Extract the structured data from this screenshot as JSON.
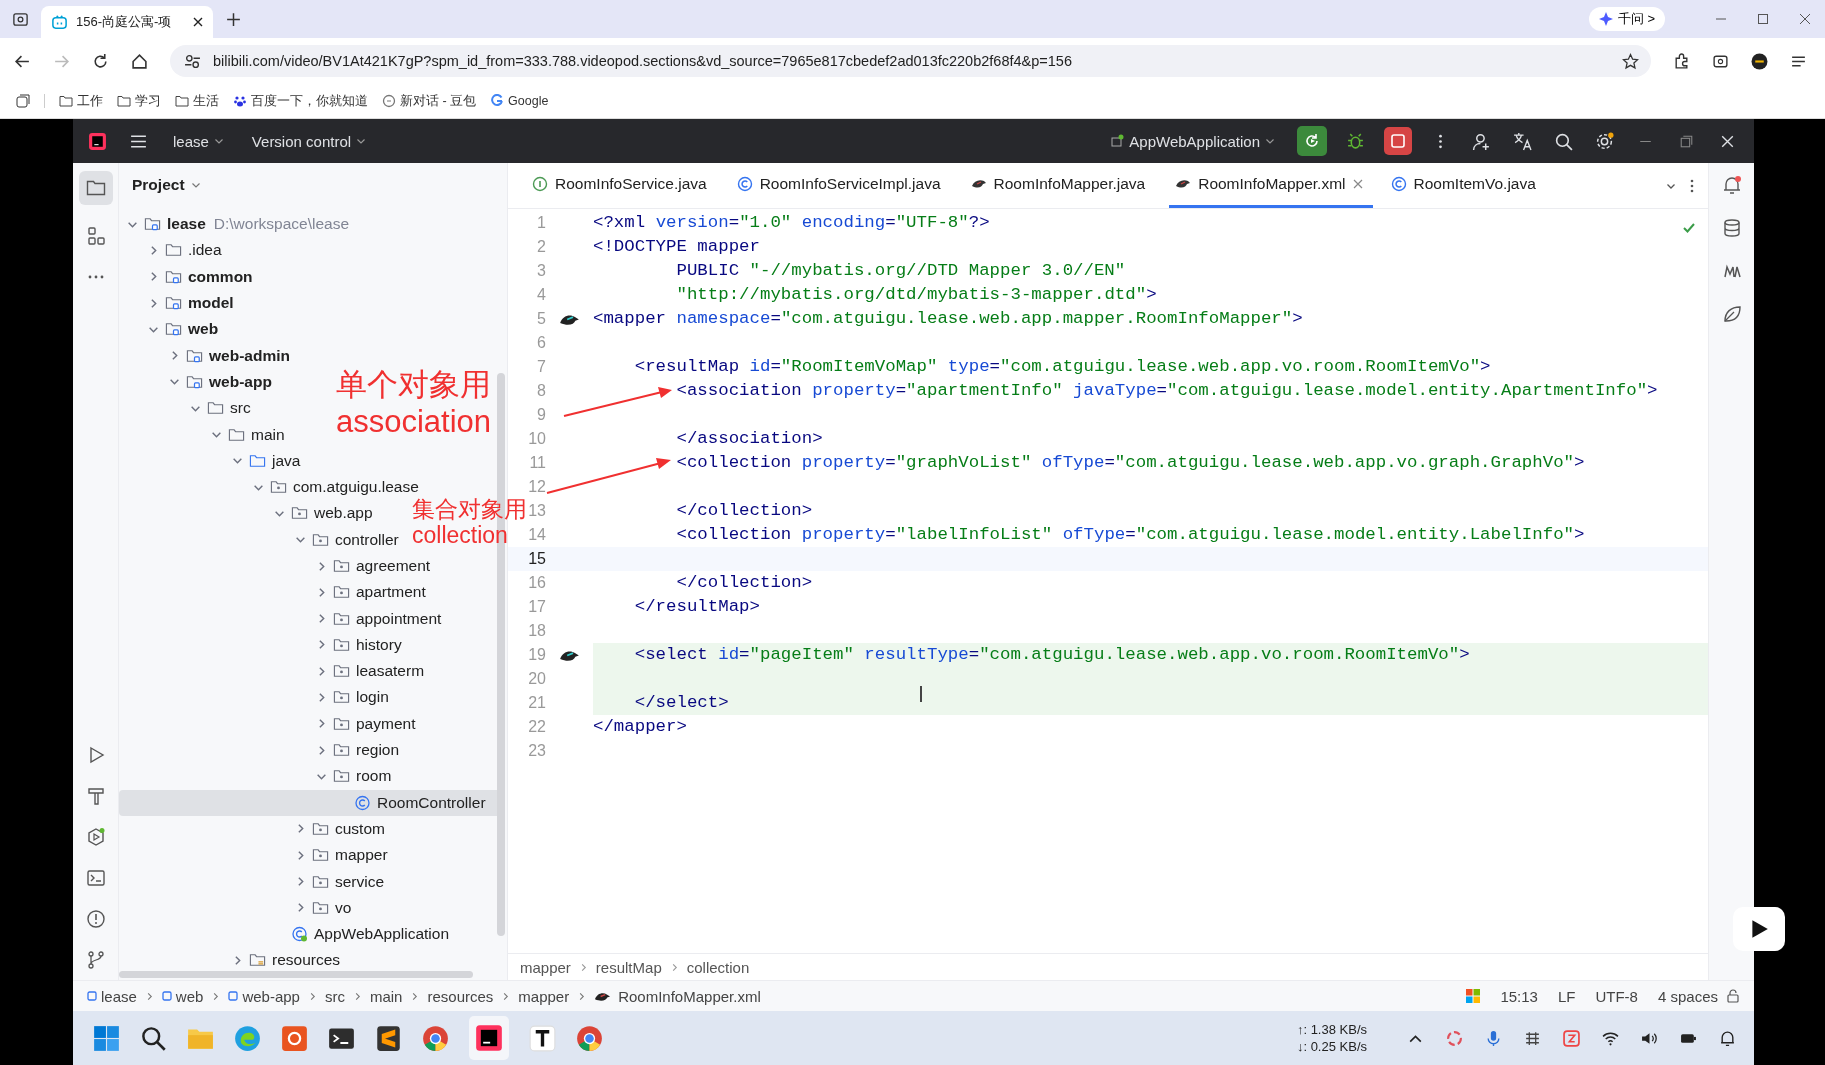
{
  "browser": {
    "tab_title": "156-尚庭公寓-项",
    "assistant": "千问 >",
    "url": "bilibili.com/video/BV1At421K7gP?spm_id_from=333.788.videopod.sections&vd_source=7965e817cbedef2ad013fc220b2f68f4&p=156",
    "bookmarks": [
      {
        "label": "工作",
        "kind": "folder"
      },
      {
        "label": "学习",
        "kind": "folder"
      },
      {
        "label": "生活",
        "kind": "folder"
      },
      {
        "label": "百度一下，你就知道",
        "kind": "paw"
      },
      {
        "label": "新对话 - 豆包",
        "kind": "chat"
      },
      {
        "label": "Google",
        "kind": "google"
      }
    ]
  },
  "ide": {
    "project": "lease",
    "vcs": "Version control",
    "run_config": "AppWebApplication",
    "panel_title": "Project",
    "tree": [
      {
        "name": "lease",
        "kind": "module",
        "hint": "D:\\workspace\\lease",
        "expanded": true,
        "selected": false,
        "children": [
          {
            "name": ".idea",
            "kind": "folder",
            "expanded": false,
            "selected": false
          },
          {
            "name": "common",
            "kind": "module",
            "expanded": false,
            "selected": false
          },
          {
            "name": "model",
            "kind": "module",
            "expanded": false,
            "selected": false
          },
          {
            "name": "web",
            "kind": "module",
            "expanded": true,
            "selected": false,
            "children": [
              {
                "name": "web-admin",
                "kind": "module",
                "expanded": false,
                "selected": false
              },
              {
                "name": "web-app",
                "kind": "module",
                "expanded": true,
                "selected": false,
                "children": [
                  {
                    "name": "src",
                    "kind": "folder",
                    "expanded": true,
                    "selected": false,
                    "children": [
                      {
                        "name": "main",
                        "kind": "folder",
                        "expanded": true,
                        "selected": false,
                        "children": [
                          {
                            "name": "java",
                            "kind": "source",
                            "expanded": true,
                            "selected": false,
                            "children": [
                              {
                                "name": "com.atguigu.lease",
                                "kind": "package",
                                "expanded": true,
                                "selected": false,
                                "children": [
                                  {
                                    "name": "web.app",
                                    "kind": "package",
                                    "expanded": true,
                                    "selected": false,
                                    "children": [
                                      {
                                        "name": "controller",
                                        "kind": "package",
                                        "expanded": true,
                                        "selected": false,
                                        "children": [
                                          {
                                            "name": "agreement",
                                            "kind": "package",
                                            "expanded": false,
                                            "selected": false
                                          },
                                          {
                                            "name": "apartment",
                                            "kind": "package",
                                            "expanded": false,
                                            "selected": false
                                          },
                                          {
                                            "name": "appointment",
                                            "kind": "package",
                                            "expanded": false,
                                            "selected": false
                                          },
                                          {
                                            "name": "history",
                                            "kind": "package",
                                            "expanded": false,
                                            "selected": false
                                          },
                                          {
                                            "name": "leasaterm",
                                            "kind": "package",
                                            "expanded": false,
                                            "selected": false
                                          },
                                          {
                                            "name": "login",
                                            "kind": "package",
                                            "expanded": false,
                                            "selected": false
                                          },
                                          {
                                            "name": "payment",
                                            "kind": "package",
                                            "expanded": false,
                                            "selected": false
                                          },
                                          {
                                            "name": "region",
                                            "kind": "package",
                                            "expanded": false,
                                            "selected": false
                                          },
                                          {
                                            "name": "room",
                                            "kind": "package",
                                            "expanded": true,
                                            "selected": false,
                                            "children": [
                                              {
                                                "name": "RoomController",
                                                "kind": "class",
                                                "selected": true
                                              }
                                            ]
                                          }
                                        ]
                                      },
                                      {
                                        "name": "custom",
                                        "kind": "package",
                                        "expanded": false,
                                        "selected": false
                                      },
                                      {
                                        "name": "mapper",
                                        "kind": "package",
                                        "expanded": false,
                                        "selected": false
                                      },
                                      {
                                        "name": "service",
                                        "kind": "package",
                                        "expanded": false,
                                        "selected": false
                                      },
                                      {
                                        "name": "vo",
                                        "kind": "package",
                                        "expanded": false,
                                        "selected": false
                                      }
                                    ]
                                  },
                                  {
                                    "name": "AppWebApplication",
                                    "kind": "spring",
                                    "selected": false
                                  }
                                ]
                              }
                            ]
                          },
                          {
                            "name": "resources",
                            "kind": "resources",
                            "expanded": false,
                            "selected": false
                          }
                        ]
                      }
                    ]
                  }
                ]
              }
            ]
          }
        ]
      }
    ],
    "tabs": [
      {
        "label": "RoomInfoService.java",
        "kind": "interface",
        "selected": false
      },
      {
        "label": "RoomInfoServiceImpl.java",
        "kind": "class",
        "selected": false
      },
      {
        "label": "RoomInfoMapper.java",
        "kind": "mapper",
        "selected": false
      },
      {
        "label": "RoomInfoMapper.xml",
        "kind": "mapper",
        "selected": true
      },
      {
        "label": "RoomItemVo.java",
        "kind": "class",
        "selected": false
      }
    ],
    "code": [
      {
        "n": "1",
        "text": "<?xml version=\"1.0\" encoding=\"UTF-8\"?>",
        "current": false,
        "changed": false,
        "gutter_icon": false
      },
      {
        "n": "2",
        "text": "<!DOCTYPE mapper",
        "current": false,
        "changed": false,
        "gutter_icon": false
      },
      {
        "n": "3",
        "text": "        PUBLIC \"-//mybatis.org//DTD Mapper 3.0//EN\"",
        "current": false,
        "changed": false,
        "gutter_icon": false
      },
      {
        "n": "4",
        "text": "        \"http://mybatis.org/dtd/mybatis-3-mapper.dtd\">",
        "current": false,
        "changed": false,
        "gutter_icon": false
      },
      {
        "n": "5",
        "text": "<mapper namespace=\"com.atguigu.lease.web.app.mapper.RoomInfoMapper\">",
        "current": false,
        "changed": false,
        "gutter_icon": true
      },
      {
        "n": "6",
        "current": false,
        "changed": false,
        "gutter_icon": false
      },
      {
        "n": "7",
        "text": "    <resultMap id=\"RoomItemVoMap\" type=\"com.atguigu.lease.web.app.vo.room.RoomItemVo\">",
        "current": false,
        "changed": false,
        "gutter_icon": false
      },
      {
        "n": "8",
        "text": "        <association property=\"apartmentInfo\" javaType=\"com.atguigu.lease.model.entity.ApartmentInfo\">",
        "current": false,
        "changed": false,
        "gutter_icon": false
      },
      {
        "n": "9",
        "current": false,
        "changed": false,
        "gutter_icon": false
      },
      {
        "n": "10",
        "text": "        </association>",
        "current": false,
        "changed": false,
        "gutter_icon": false
      },
      {
        "n": "11",
        "text": "        <collection property=\"graphVoList\" ofType=\"com.atguigu.lease.web.app.vo.graph.GraphVo\">",
        "current": false,
        "changed": false,
        "gutter_icon": false
      },
      {
        "n": "12",
        "current": false,
        "changed": false,
        "gutter_icon": false
      },
      {
        "n": "13",
        "text": "        </collection>",
        "current": false,
        "changed": false,
        "gutter_icon": false
      },
      {
        "n": "14",
        "text": "        <collection property=\"labelInfoList\" ofType=\"com.atguigu.lease.model.entity.LabelInfo\">",
        "current": false,
        "changed": false,
        "gutter_icon": false
      },
      {
        "n": "15",
        "current": true,
        "changed": false,
        "gutter_icon": false
      },
      {
        "n": "16",
        "text": "        </collection>",
        "current": false,
        "changed": false,
        "gutter_icon": false
      },
      {
        "n": "17",
        "text": "    </resultMap>",
        "current": false,
        "changed": false,
        "gutter_icon": false
      },
      {
        "n": "18",
        "current": false,
        "changed": false,
        "gutter_icon": false
      },
      {
        "n": "19",
        "text": "    <select id=\"pageItem\" resultType=\"com.atguigu.lease.web.app.vo.room.RoomItemVo\">",
        "current": false,
        "changed": true,
        "gutter_icon": true
      },
      {
        "n": "20",
        "current": false,
        "changed": true,
        "gutter_icon": false
      },
      {
        "n": "21",
        "text": "    </select>",
        "current": false,
        "changed": true,
        "gutter_icon": false
      },
      {
        "n": "22",
        "text": "</mapper>",
        "current": false,
        "changed": false,
        "gutter_icon": false
      },
      {
        "n": "23",
        "current": false,
        "changed": false,
        "gutter_icon": false
      }
    ],
    "editor_breadcrumb": [
      "mapper",
      "resultMap",
      "collection"
    ],
    "path": [
      "lease",
      "web",
      "web-app",
      "src",
      "main",
      "resources",
      "mapper",
      "RoomInfoMapper.xml"
    ],
    "status": {
      "position": "15:13",
      "line_sep": "LF",
      "encoding": "UTF-8",
      "indent": "4 spaces"
    }
  },
  "annotations": [
    {
      "lines": [
        "单个对象用",
        "association"
      ]
    },
    {
      "lines": [
        "集合对象用 collection"
      ]
    }
  ],
  "taskbar": {
    "upload": "↑: 1.38 KB/s",
    "download": "↓: 0.25 KB/s"
  }
}
